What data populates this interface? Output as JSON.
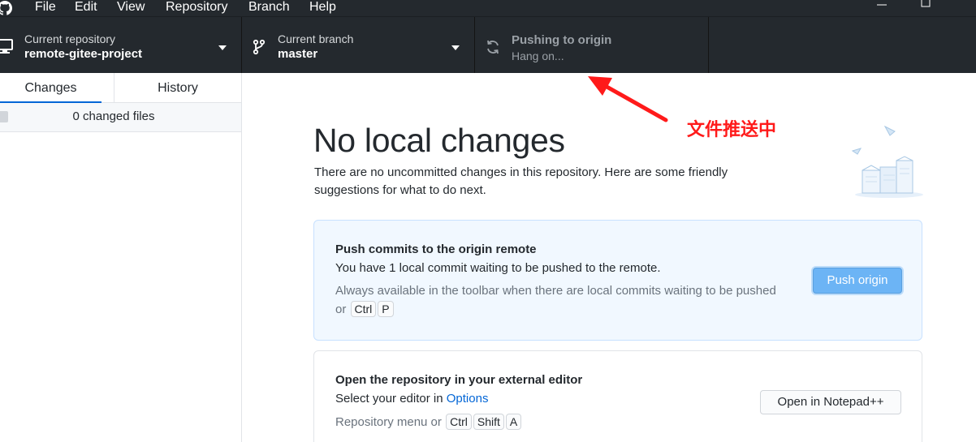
{
  "menubar": {
    "items": [
      "File",
      "Edit",
      "View",
      "Repository",
      "Branch",
      "Help"
    ],
    "minimize_icon": "minimize-icon",
    "maximize_icon": "maximize-icon"
  },
  "toolbar": {
    "repo_label": "Current repository",
    "repo_value": "remote-gitee-project",
    "branch_label": "Current branch",
    "branch_value": "master",
    "push_label": "Pushing to origin",
    "push_value": "Hang on..."
  },
  "sidebar": {
    "tabs": [
      "Changes",
      "History"
    ],
    "active_tab": "Changes",
    "changed_files": "0 changed files"
  },
  "main": {
    "heading": "No local changes",
    "subtext": "There are no uncommitted changes in this repository. Here are some friendly suggestions for what to do next.",
    "push_card": {
      "title": "Push commits to the origin remote",
      "desc": "You have 1 local commit waiting to be pushed to the remote.",
      "note_prefix": "Always available in the toolbar when there are local commits waiting to be pushed or",
      "keys": [
        "Ctrl",
        "P"
      ],
      "button": "Push origin"
    },
    "editor_card": {
      "title": "Open the repository in your external editor",
      "desc_prefix": "Select your editor in",
      "desc_link": "Options",
      "note_prefix": "Repository menu or",
      "keys": [
        "Ctrl",
        "Shift",
        "A"
      ],
      "button": "Open in Notepad++"
    }
  },
  "annotation": {
    "text": "文件推送中"
  },
  "colors": {
    "toolbar_bg": "#24292e",
    "accent": "#0366d6",
    "primary_button": "#6cb4f5",
    "annotation": "#ff1a1a"
  }
}
